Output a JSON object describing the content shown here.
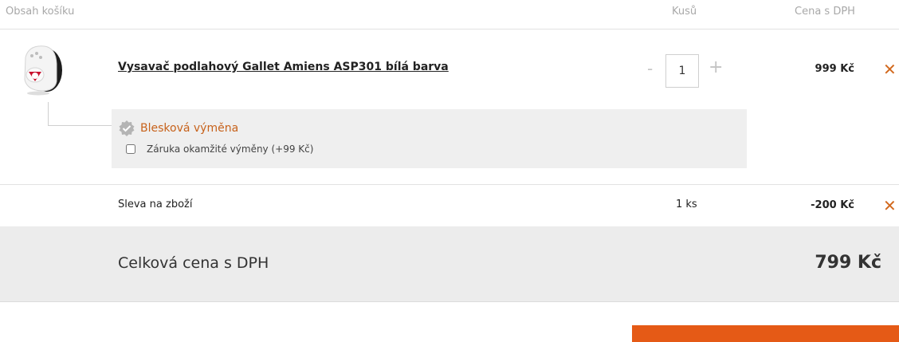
{
  "table": {
    "header": {
      "items": "Obsah košíku",
      "quantity": "Kusů",
      "price": "Cena s DPH"
    }
  },
  "product": {
    "name": "Vysavač podlahový Gallet Amiens ASP301 bílá barva",
    "quantity": "1",
    "price": "999 Kč",
    "image_icon": "vacuum-cleaner-icon"
  },
  "service": {
    "title": "Blesková výměna",
    "option_label": "Záruka okamžité výměny (+99 Kč)",
    "option_checked": false,
    "icon": "badge-check-icon"
  },
  "discount": {
    "label": "Sleva na zboží",
    "quantity": "1 ks",
    "price": "-200 Kč"
  },
  "total": {
    "label": "Celková cena s DPH",
    "value": "799 Kč"
  },
  "controls": {
    "minus": "-",
    "plus": "+",
    "remove": "✕"
  },
  "colors": {
    "accent_orange": "#e55a16",
    "service_title": "#c7621b",
    "remove_icon": "#d2691e"
  }
}
